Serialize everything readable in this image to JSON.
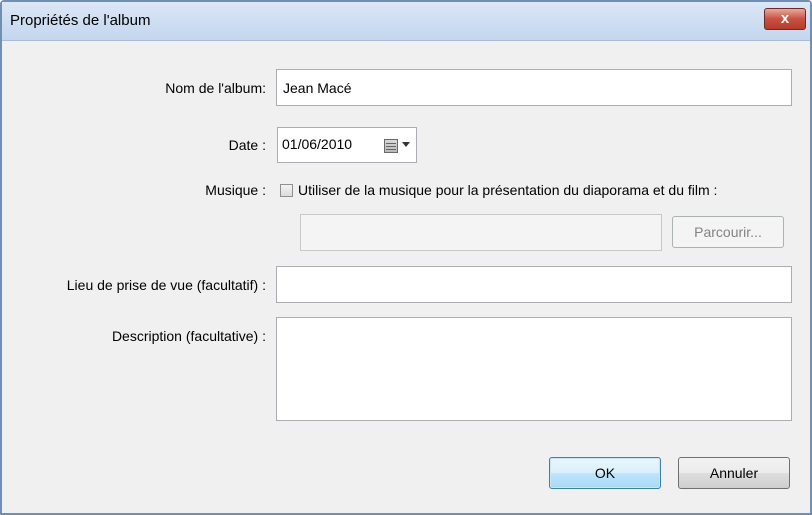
{
  "window": {
    "title": "Propriétés de l'album",
    "close_label": "x"
  },
  "album_name": {
    "label": "Nom de l'album:",
    "value": "Jean Macé"
  },
  "date": {
    "label": "Date :",
    "value": "01/06/2010"
  },
  "music": {
    "label": "Musique :",
    "checkbox_label": "Utiliser de la musique pour la présentation du diaporama et du film :",
    "checked": false,
    "path_value": "",
    "browse_label": "Parcourir..."
  },
  "location": {
    "label": "Lieu de prise de vue (facultatif) :",
    "value": ""
  },
  "description": {
    "label": "Description (facultative) :",
    "value": ""
  },
  "buttons": {
    "ok_label": "OK",
    "cancel_label": "Annuler"
  }
}
